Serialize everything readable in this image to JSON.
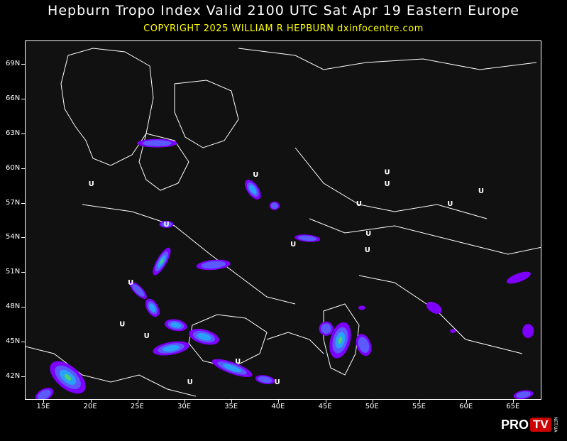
{
  "header": {
    "title": "Hepburn Tropo Index Valid 2100 UTC Sat Apr 19 Eastern Europe",
    "subtitle": "COPYRIGHT 2025   WILLIAM R HEPBURN   dxinfocentre.com"
  },
  "map": {
    "lat_labels": [
      "69N",
      "66N",
      "63N",
      "60N",
      "57N",
      "54N",
      "51N",
      "48N",
      "45N",
      "42N"
    ],
    "lon_labels": [
      "15E",
      "20E",
      "25E",
      "30E",
      "35E",
      "40E",
      "45E",
      "50E",
      "55E",
      "60E",
      "65E"
    ],
    "lat_range": [
      40,
      71
    ],
    "lon_range": [
      13,
      68
    ],
    "background": "#111111",
    "coastline_color": "#ffffff",
    "marker_symbol": "U",
    "markers": [
      {
        "lat": 58.5,
        "lon": 20.0
      },
      {
        "lat": 59.3,
        "lon": 37.5
      },
      {
        "lat": 58.5,
        "lon": 51.5
      },
      {
        "lat": 59.5,
        "lon": 51.5
      },
      {
        "lat": 57.9,
        "lon": 61.5
      },
      {
        "lat": 56.8,
        "lon": 48.5
      },
      {
        "lat": 56.8,
        "lon": 58.2
      },
      {
        "lat": 55.0,
        "lon": 28.0
      },
      {
        "lat": 53.3,
        "lon": 41.5
      },
      {
        "lat": 54.2,
        "lon": 49.5
      },
      {
        "lat": 52.8,
        "lon": 49.4
      },
      {
        "lat": 50.0,
        "lon": 24.2
      },
      {
        "lat": 46.4,
        "lon": 23.3
      },
      {
        "lat": 45.4,
        "lon": 25.9
      },
      {
        "lat": 43.2,
        "lon": 35.6
      },
      {
        "lat": 41.4,
        "lon": 30.5
      },
      {
        "lat": 41.4,
        "lon": 39.8
      }
    ],
    "index_colors": [
      "#7d00ff",
      "#5a5aff",
      "#2aa0ff",
      "#4dd070",
      "#ffff00"
    ]
  },
  "logo": {
    "brand_a": "PRO",
    "brand_b": "TV",
    "brand_small": "NET.UA"
  }
}
